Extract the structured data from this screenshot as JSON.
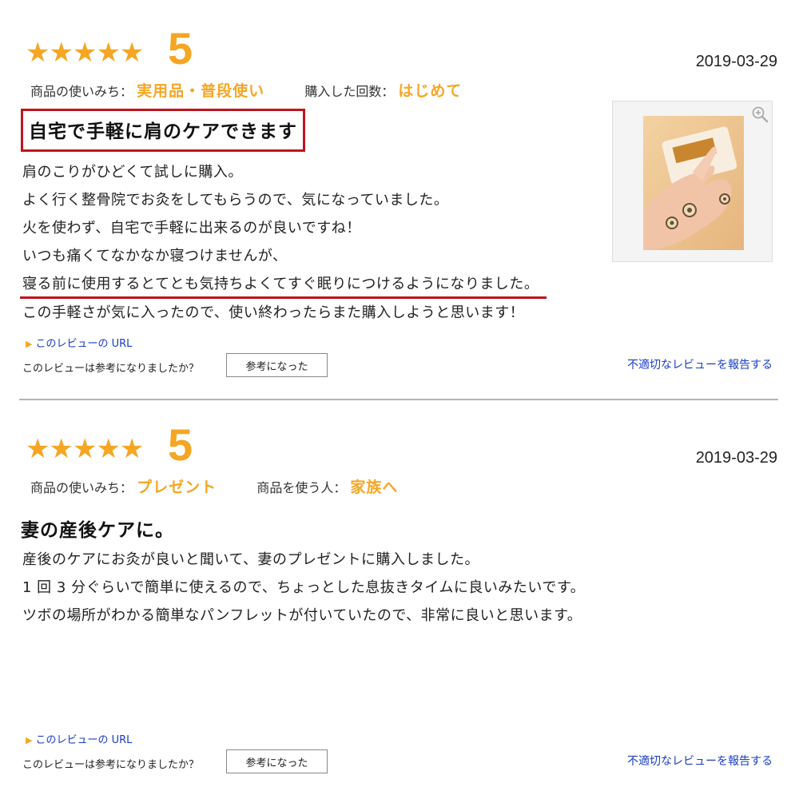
{
  "reviews": [
    {
      "stars": "★★★★★",
      "score": "5",
      "date": "2019-03-29",
      "meta1_label": "商品の使いみち：",
      "meta1_value": "実用品・普段使い",
      "meta2_label": "購入した回数：",
      "meta2_value": "はじめて",
      "title": "自宅で手軽に肩のケアできます",
      "body": [
        "肩のこりがひどくて試しに購入。",
        "よく行く整骨院でお灸をしてもらうので、気になっていました。",
        "火を使わず、自宅で手軽に出来るのが良いですね！",
        "いつも痛くてなかなか寝つけませんが、",
        "寝る前に使用するとてとも気持ちよくてすぐ眠りにつけるようになりました。",
        "この手軽さが気に入ったので、使い終わったらまた購入しようと思います！"
      ],
      "url_link": "このレビューの URL",
      "helpful_question": "このレビューは参考になりましたか？",
      "helpful_button": "参考になった",
      "report_link": "不適切なレビューを報告する"
    },
    {
      "stars": "★★★★★",
      "score": "5",
      "date": "2019-03-29",
      "meta1_label": "商品の使いみち：",
      "meta1_value": "プレゼント",
      "meta2_label": "商品を使う人：",
      "meta2_value": "家族へ",
      "title": "妻の産後ケアに。",
      "body": [
        "産後のケアにお灸が良いと聞いて、妻のプレゼントに購入しました。",
        "1 回 3 分ぐらいで簡単に使えるので、ちょっとした息抜きタイムに良いみたいです。",
        "ツボの場所がわかる簡単なパンフレットが付いていたので、非常に良いと思います。"
      ],
      "url_link": "このレビューの URL",
      "helpful_question": "このレビューは参考になりましたか？",
      "helpful_button": "参考になった",
      "report_link": "不適切なレビューを報告する"
    }
  ],
  "colors": {
    "accent_orange": "#f5a623",
    "highlight_red": "#c0141c",
    "link_blue": "#1a3cc6",
    "divider_gray": "#b5b5b5"
  },
  "icons": {
    "rating": "star-icon",
    "zoom": "zoom-in-icon",
    "link_marker": "triangle-right-icon"
  }
}
